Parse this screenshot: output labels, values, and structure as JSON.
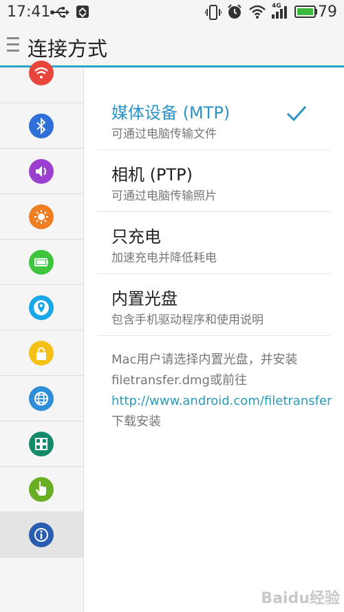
{
  "status_bar": {
    "time": "17:41",
    "battery_percent": "79",
    "network_label": "4G",
    "icons": [
      "usb-icon",
      "data-sync-icon",
      "vibrate-icon",
      "alarm-icon",
      "wifi-icon",
      "signal-icon",
      "battery-icon"
    ]
  },
  "header": {
    "title": "连接方式",
    "menu_icon": "menu-icon"
  },
  "sidebar": {
    "items": [
      {
        "icon": "wifi-icon",
        "color": "#e8453c"
      },
      {
        "icon": "bluetooth-icon",
        "color": "#2e6fd8"
      },
      {
        "icon": "sound-icon",
        "color": "#9b3fd0"
      },
      {
        "icon": "brightness-icon",
        "color": "#ef7d22"
      },
      {
        "icon": "battery-icon",
        "color": "#3ec43e"
      },
      {
        "icon": "location-icon",
        "color": "#19a7e8"
      },
      {
        "icon": "lock-icon",
        "color": "#f5c016"
      },
      {
        "icon": "globe-icon",
        "color": "#2e8fd8"
      },
      {
        "icon": "apps-icon",
        "color": "#138a6a"
      },
      {
        "icon": "touch-icon",
        "color": "#6aae23"
      },
      {
        "icon": "info-icon",
        "color": "#2a5db0"
      }
    ]
  },
  "options": [
    {
      "title": "媒体设备 (MTP)",
      "subtitle": "可通过电脑传输文件",
      "selected": true
    },
    {
      "title": "相机 (PTP)",
      "subtitle": "可通过电脑传输照片",
      "selected": false
    },
    {
      "title": "只充电",
      "subtitle": "加速充电并降低耗电",
      "selected": false
    },
    {
      "title": "内置光盘",
      "subtitle": "包含手机驱动程序和使用说明",
      "selected": false
    }
  ],
  "note": {
    "prefix": "Mac用户请选择内置光盘，并安装filetransfer.dmg或前往",
    "link": "http://www.android.com/filetransfer",
    "suffix": "下载安装"
  },
  "watermark": "Baidu经验",
  "colors": {
    "accent": "#2a93c1",
    "header_line": "#27a3c7",
    "link": "#2a9ab8"
  }
}
